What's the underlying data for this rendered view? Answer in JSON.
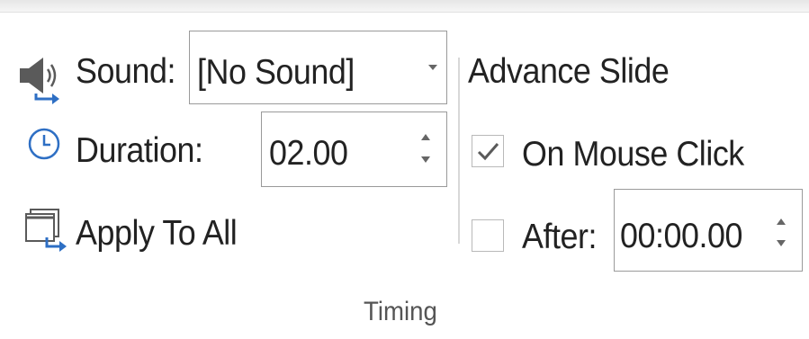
{
  "ribbon_group": {
    "title": "Timing",
    "sound": {
      "label": "Sound:",
      "value": "[No Sound]",
      "icon": "speaker-icon"
    },
    "duration": {
      "label": "Duration:",
      "value": "02.00",
      "icon": "clock-icon"
    },
    "apply_to_all": {
      "label": "Apply To All",
      "icon": "apply-to-all-icon"
    },
    "advance_slide": {
      "heading": "Advance Slide",
      "on_mouse_click": {
        "label": "On Mouse Click",
        "checked": true
      },
      "after": {
        "label": "After:",
        "checked": false,
        "value": "00:00.00"
      }
    }
  },
  "colors": {
    "accent_blue": "#2e6fc4",
    "text": "#222222",
    "field_border": "#9a9a9a",
    "divider": "#d8d8d8"
  }
}
